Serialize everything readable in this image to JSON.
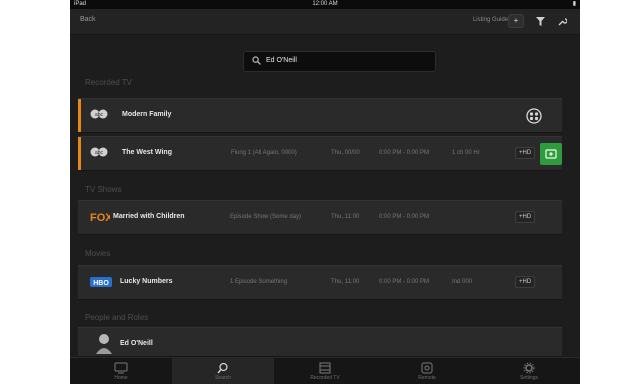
{
  "status_bar": {
    "carrier": "iPad",
    "time": "12:00 AM",
    "battery": ""
  },
  "nav": {
    "back_label": "Back",
    "title": "",
    "right_label": "Listing Guide",
    "buttons": [
      "add",
      "filter",
      "tools"
    ]
  },
  "search": {
    "value": "Ed O'Neill",
    "placeholder": ""
  },
  "sections": [
    {
      "title": "Recorded TV",
      "rows": [
        {
          "title": "Modern Family",
          "logo": "abc",
          "accent": "#e8861a",
          "episode": "",
          "date": "",
          "time": "",
          "channel": "",
          "badge": "",
          "action": "reel-icon"
        },
        {
          "title": "The West Wing",
          "logo": "abc",
          "accent": "#e8861a",
          "episode": "Flung 1 (All Again, 0000)",
          "date": "Thu, 00/00",
          "time": "0:00 PM - 0:00 PM",
          "channel": "1 ch 00 Hr",
          "badge": "+HD",
          "action": "record-button"
        }
      ]
    },
    {
      "title": "TV Shows",
      "rows": [
        {
          "title": "Married with Children",
          "logo": "FOX",
          "episode": "Episode Show (Some day)",
          "date": "Thu, 11:00",
          "time": "0:00 PM - 0:00 PM",
          "badge": "+HD"
        }
      ]
    },
    {
      "title": "Movies",
      "rows": [
        {
          "title": "Lucky Numbers",
          "logo": "HBO",
          "episode": "1 Episode  Something",
          "date": "Thu, 11:00",
          "time": "0:00 PM - 0:00 PM",
          "channel": "Ind 000",
          "badge": "+HD"
        }
      ]
    },
    {
      "title": "People and Roles",
      "rows": [
        {
          "title": "Ed O'Neill",
          "logo": "person-photo"
        }
      ]
    }
  ],
  "tabs": [
    {
      "label": "Home",
      "icon": "tv-icon"
    },
    {
      "label": "Search",
      "icon": "search-icon",
      "active": true
    },
    {
      "label": "Recorded TV",
      "icon": "film-icon"
    },
    {
      "label": "Remote",
      "icon": "remote-icon"
    },
    {
      "label": "Settings",
      "icon": "gear-icon"
    }
  ],
  "colors": {
    "accent": "#e8861a",
    "record": "#2f9b3c",
    "background": "#1f1f1f"
  }
}
